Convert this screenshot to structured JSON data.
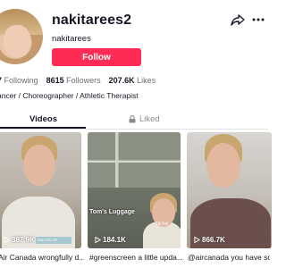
{
  "profile": {
    "username": "nakitarees2",
    "nickname": "nakitarees",
    "follow_label": "Follow",
    "bio": "ancer / Choreographer / Athletic Therapist"
  },
  "stats": [
    {
      "value": "7",
      "label": "Following"
    },
    {
      "value": "8615",
      "label": "Followers"
    },
    {
      "value": "207.6K",
      "label": "Likes"
    }
  ],
  "tabs": {
    "videos": "Videos",
    "liked": "Liked"
  },
  "videos": [
    {
      "views": "387.9K",
      "caption": "Air Canada wrongfully d...",
      "strip": "WATION OF"
    },
    {
      "views": "184.1K",
      "caption": "#greenscreen a little upda...",
      "overlay_title": "Tom's Luggage",
      "overlay_tag": "TikTok"
    },
    {
      "views": "866.7K",
      "caption": "@aircanada you have som..."
    }
  ],
  "icons": {
    "share": "share-arrow-icon",
    "more": "more-horizontal-icon",
    "lock": "lock-icon",
    "play": "play-icon"
  },
  "colors": {
    "accent": "#fe2c55",
    "text": "#161823",
    "muted": "#8a8b91"
  }
}
